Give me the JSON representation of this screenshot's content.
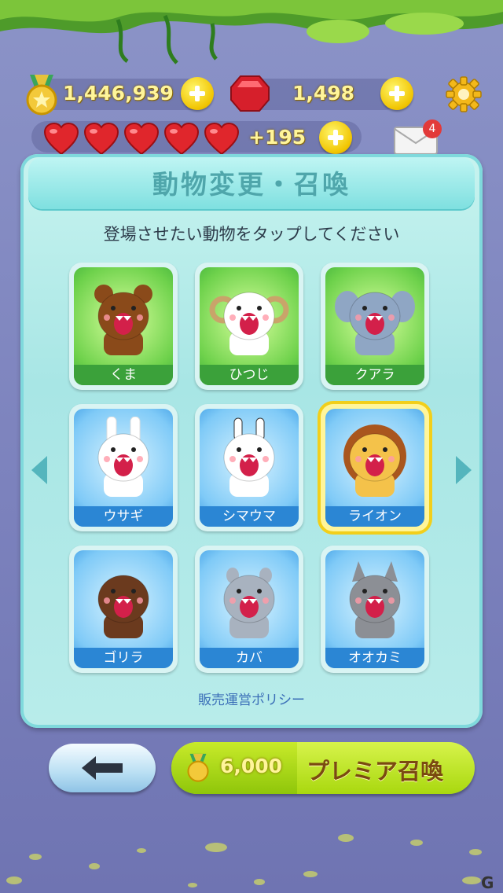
{
  "header": {
    "coins": "1,446,939",
    "gems": "1,498",
    "hearts_count": 5,
    "hearts_extra": "+195",
    "mail_badge": "4"
  },
  "panel": {
    "title": "動物変更・召喚",
    "instruction": "登場させたい動物をタップしてください",
    "policy_link": "販売運営ポリシー"
  },
  "animals": [
    {
      "label": "くま",
      "tile_color": "green",
      "selected": false
    },
    {
      "label": "ひつじ",
      "tile_color": "green",
      "selected": false
    },
    {
      "label": "クアラ",
      "tile_color": "green",
      "selected": false
    },
    {
      "label": "ウサギ",
      "tile_color": "blue",
      "selected": false
    },
    {
      "label": "シマウマ",
      "tile_color": "blue",
      "selected": false
    },
    {
      "label": "ライオン",
      "tile_color": "blue",
      "selected": true
    },
    {
      "label": "ゴリラ",
      "tile_color": "blue",
      "selected": false
    },
    {
      "label": "カバ",
      "tile_color": "blue",
      "selected": false
    },
    {
      "label": "オオカミ",
      "tile_color": "blue",
      "selected": false
    }
  ],
  "footer": {
    "premium_cost": "6,000",
    "premium_label": "プレミア召喚"
  },
  "colors": {
    "accent_green": "#a9d80f",
    "coin_yellow": "#f1c400",
    "panel_teal": "#a8e6e5"
  }
}
